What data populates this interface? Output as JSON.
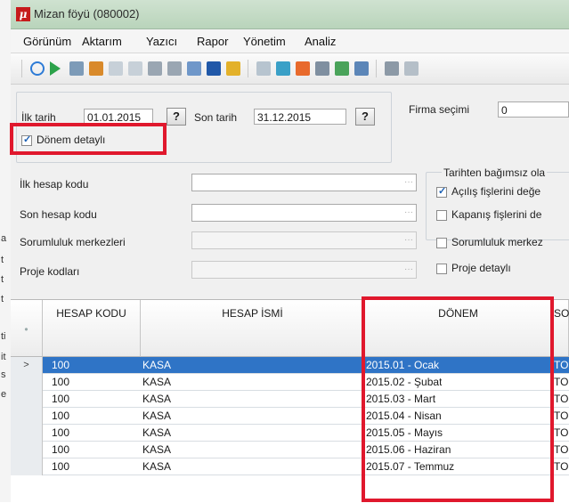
{
  "window": {
    "title": "Mizan föyü (080002)"
  },
  "menu": [
    "Görünüm",
    "Aktarım",
    "Yazıcı",
    "Rapor",
    "Yönetim",
    "Analiz"
  ],
  "dates": {
    "start_label": "İlk tarih",
    "start_value": "01.01.2015",
    "end_label": "Son tarih",
    "end_value": "31.12.2015",
    "picker_label": "?"
  },
  "firm": {
    "label": "Firma seçimi",
    "value": "0"
  },
  "period_detail": {
    "label": "Dönem detaylı",
    "checked": true
  },
  "filters": {
    "first_account": "İlk hesap kodu",
    "last_account": "Son hesap kodu",
    "responsibility": "Sorumluluk merkezleri",
    "project": "Proje kodları"
  },
  "right_group": {
    "title": "Tarihten bağımsız ola",
    "opening": {
      "label": "Açılış fişlerini değe",
      "checked": true
    },
    "closing": {
      "label": "Kapanış fişlerini de",
      "checked": false
    },
    "resp_detail": {
      "label": "Sorumluluk merkez",
      "checked": false
    },
    "project_detail": {
      "label": "Proje detaylı",
      "checked": false
    }
  },
  "grid": {
    "columns": {
      "code": "HESAP KODU",
      "name": "HESAP İSMİ",
      "period": "DÖNEM",
      "next": "SO"
    },
    "rows": [
      {
        "code": "100",
        "name": "KASA",
        "period": "2015.01 - Ocak",
        "next": "TO",
        "selected": true
      },
      {
        "code": "100",
        "name": "KASA",
        "period": "2015.02 - Şubat",
        "next": "TO"
      },
      {
        "code": "100",
        "name": "KASA",
        "period": "2015.03 - Mart",
        "next": "TO"
      },
      {
        "code": "100",
        "name": "KASA",
        "period": "2015.04 - Nisan",
        "next": "TO"
      },
      {
        "code": "100",
        "name": "KASA",
        "period": "2015.05 - Mayıs",
        "next": "TO"
      },
      {
        "code": "100",
        "name": "KASA",
        "period": "2015.06 - Haziran",
        "next": "TO"
      },
      {
        "code": "100",
        "name": "KASA",
        "period": "2015.07 - Temmuz",
        "next": "TO"
      }
    ],
    "row_marker": ">"
  },
  "left_strip_chars": [
    "a",
    "t",
    "t",
    "a",
    "n",
    "t",
    "t",
    "it",
    "ti",
    "s",
    "e"
  ],
  "colors": {
    "highlight": "#e0182d",
    "selection": "#2f74c6"
  }
}
